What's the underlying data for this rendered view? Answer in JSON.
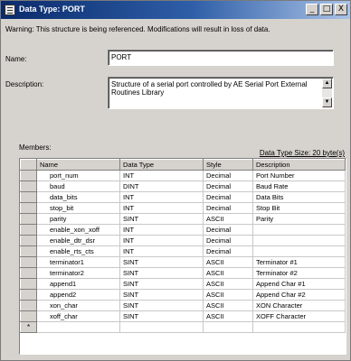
{
  "window": {
    "title": "Data Type: PORT",
    "controls": [
      "_",
      "□",
      "X"
    ]
  },
  "warning": "Warning: This structure is being referenced. Modifications will result in loss of data.",
  "name": {
    "label": "Name:",
    "value": "PORT"
  },
  "description": {
    "label": "Description:",
    "value": "Structure of a serial port controlled by AE Serial Port External Routines Library"
  },
  "members": {
    "label": "Members:",
    "size_text": "Data Type Size: 20 byte(s)",
    "columns": [
      "Name",
      "Data Type",
      "Style",
      "Description"
    ],
    "rows": [
      [
        "port_num",
        "INT",
        "Decimal",
        "Port Number"
      ],
      [
        "baud",
        "DINT",
        "Decimal",
        "Baud Rate"
      ],
      [
        "data_bits",
        "INT",
        "Decimal",
        "Data Bits"
      ],
      [
        "stop_bit",
        "INT",
        "Decimal",
        "Stop Bit"
      ],
      [
        "parity",
        "SINT",
        "ASCII",
        "Parity"
      ],
      [
        "enable_xon_xoff",
        "INT",
        "Decimal",
        ""
      ],
      [
        "enable_dtr_dsr",
        "INT",
        "Decimal",
        ""
      ],
      [
        "enable_rts_cts",
        "INT",
        "Decimal",
        ""
      ],
      [
        "terminator1",
        "SINT",
        "ASCII",
        "Terminator #1"
      ],
      [
        "terminator2",
        "SINT",
        "ASCII",
        "Terminator #2"
      ],
      [
        "append1",
        "SINT",
        "ASCII",
        "Append Char #1"
      ],
      [
        "append2",
        "SINT",
        "ASCII",
        "Append Char #2"
      ],
      [
        "xon_char",
        "SINT",
        "ASCII",
        "XON Character"
      ],
      [
        "xoff_char",
        "SINT",
        "ASCII",
        "XOFF Character"
      ]
    ],
    "new_row_marker": "*"
  }
}
